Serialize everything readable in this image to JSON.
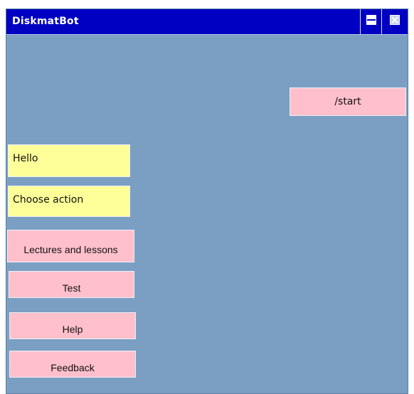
{
  "window": {
    "title": "DiskmatBot",
    "minimize_icon": "minimize-icon",
    "close_icon": "close-icon"
  },
  "colors": {
    "titlebar": "#0000c2",
    "background": "#7b9fc3",
    "user_bubble": "#ffc0cb",
    "bot_bubble": "#ffff99"
  },
  "chat": {
    "user_messages": [
      {
        "text": "/start"
      }
    ],
    "bot_messages": [
      {
        "text": "Hello"
      },
      {
        "text": "Choose action"
      }
    ]
  },
  "actions": [
    {
      "label": "Lectures and lessons"
    },
    {
      "label": "Test"
    },
    {
      "label": "Help"
    },
    {
      "label": "Feedback"
    }
  ]
}
